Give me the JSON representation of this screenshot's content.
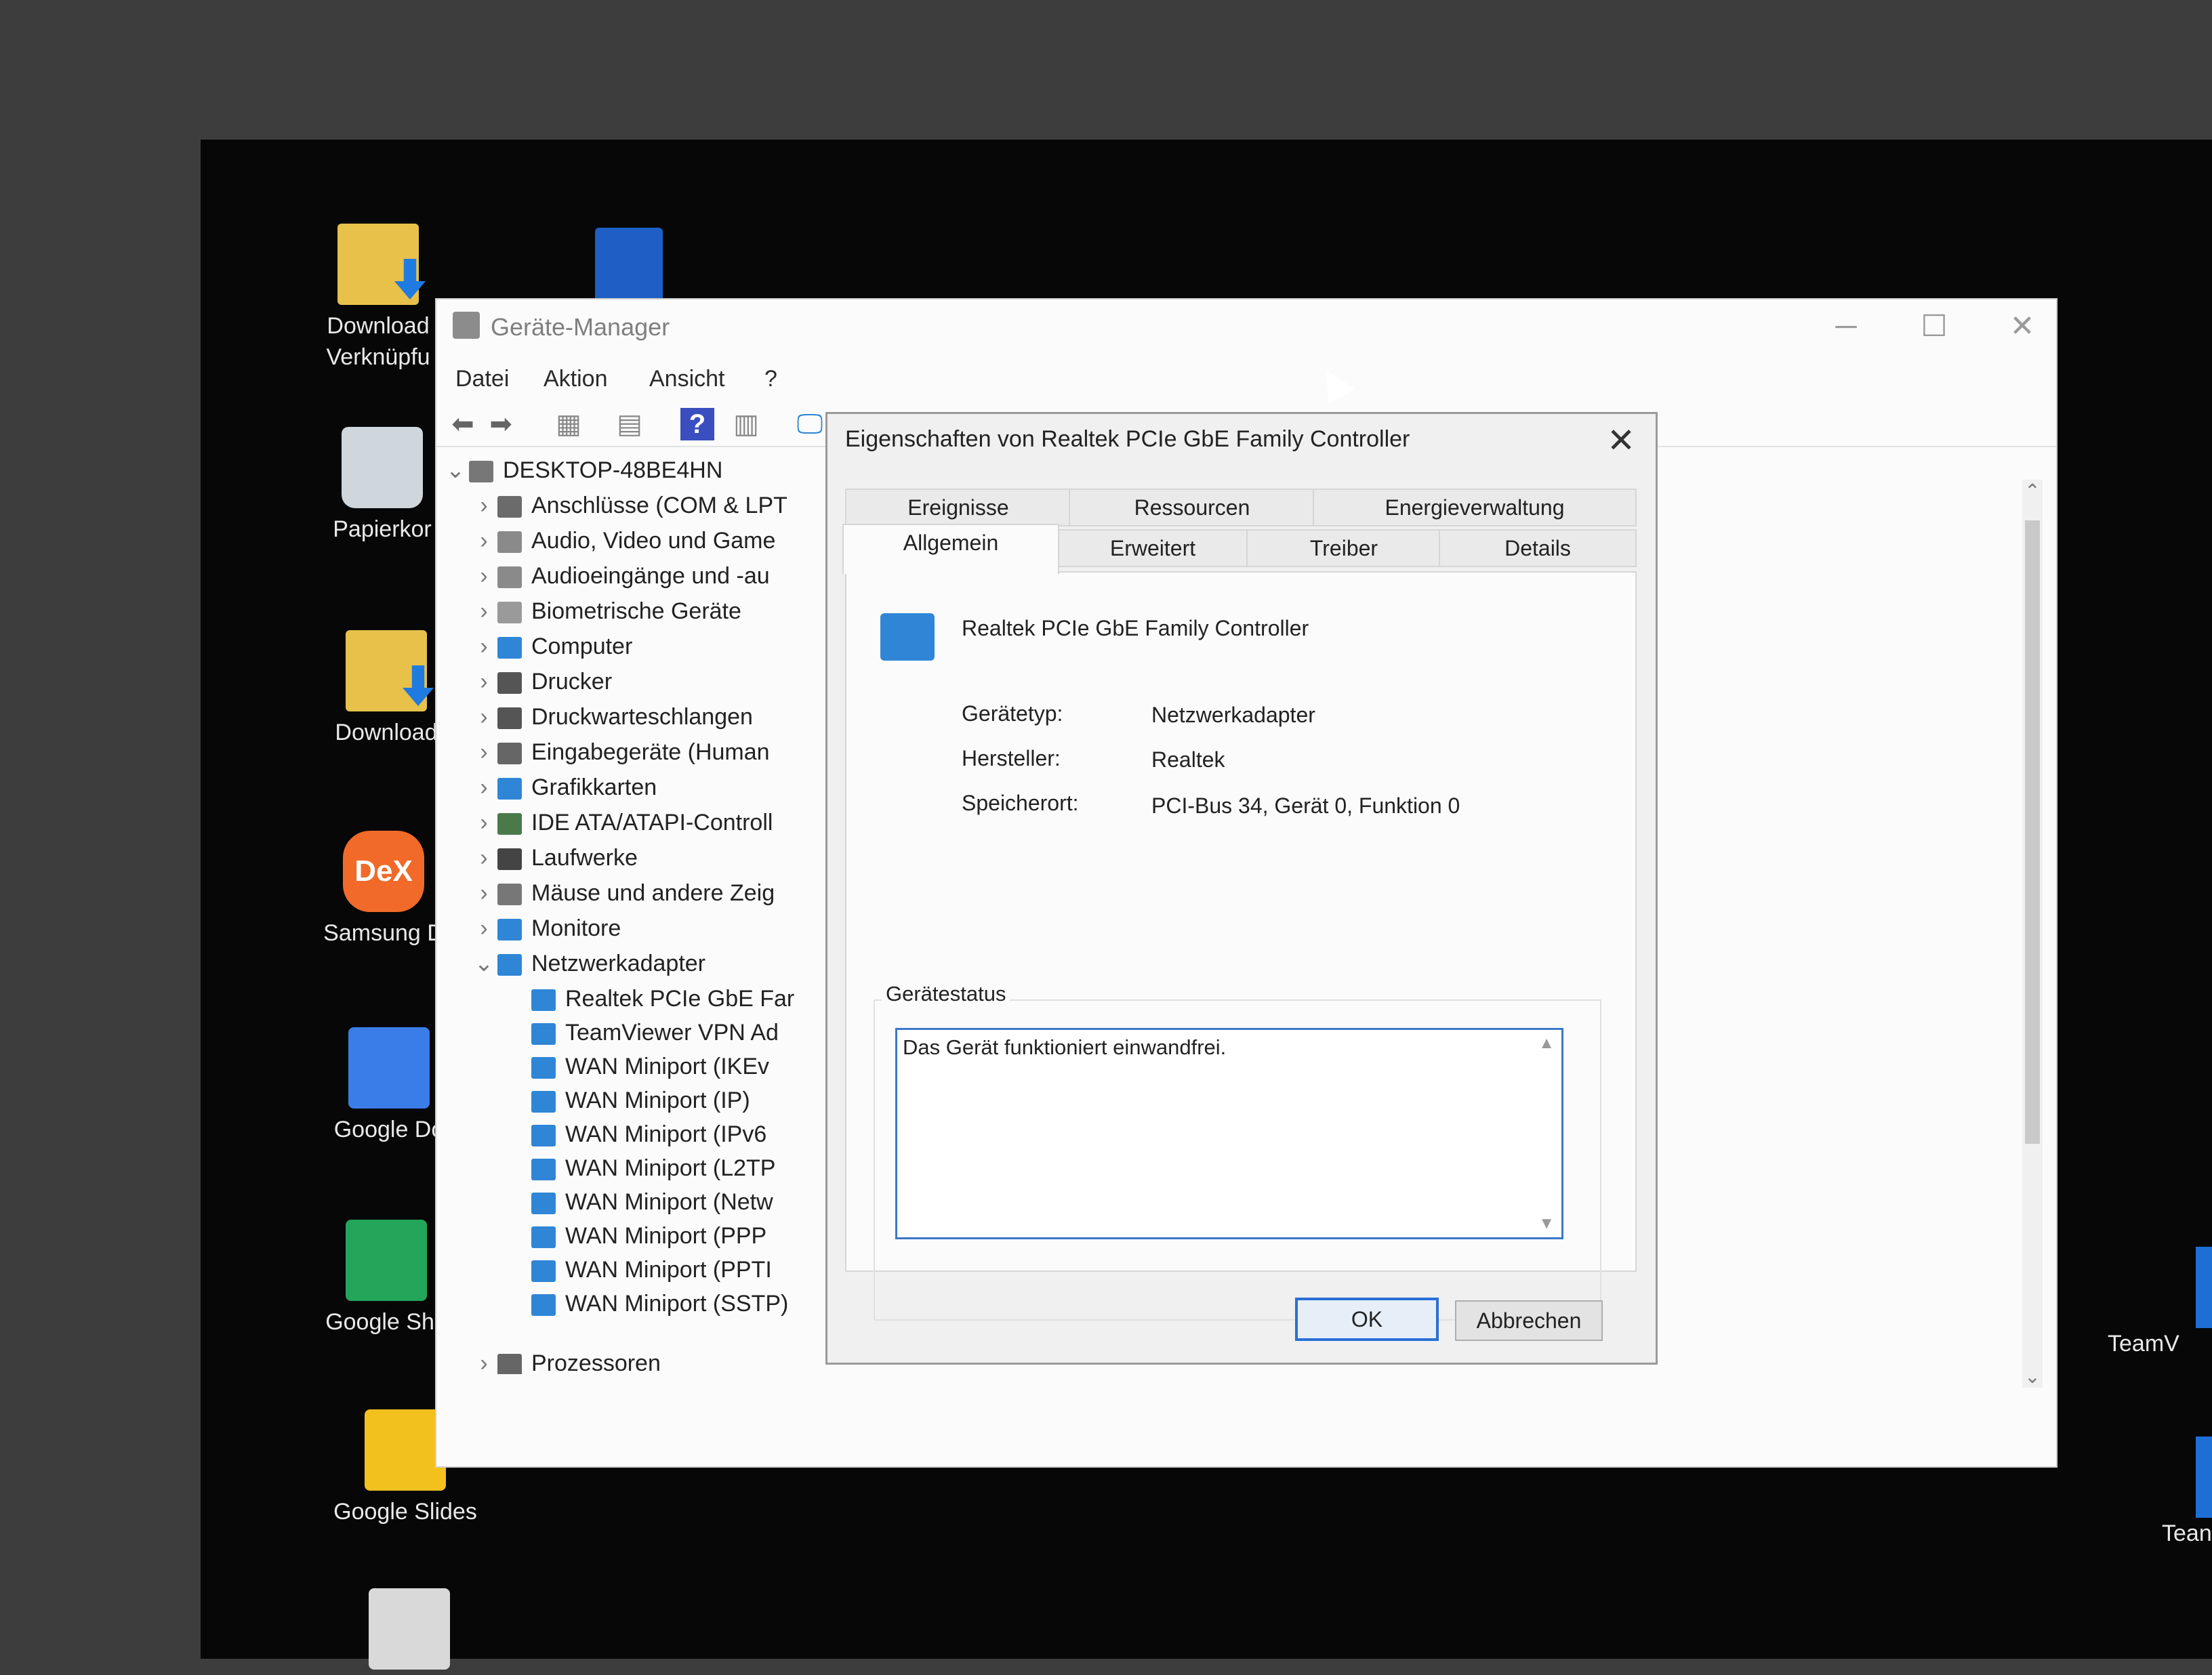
{
  "desktop": {
    "icons": [
      {
        "label": "Download\nVerknüpfu",
        "glyph": "folder-download-icon"
      },
      {
        "label": "Papierkor",
        "glyph": "recycle-bin-icon"
      },
      {
        "label": "Download",
        "glyph": "folder-download-icon"
      },
      {
        "label": "DeX",
        "glyph": "samsung-dex-icon"
      },
      {
        "label": "Samsung D",
        "glyph": "samsung-dex-icon"
      },
      {
        "label": "Google Do",
        "glyph": "google-docs-icon"
      },
      {
        "label": "Google She",
        "glyph": "google-sheets-icon"
      },
      {
        "label": "Google Slides",
        "glyph": "google-slides-icon"
      },
      {
        "label": "TeamV",
        "glyph": "teamviewer-icon"
      },
      {
        "label": "Tean",
        "glyph": "teamviewer-icon"
      }
    ]
  },
  "window": {
    "title": "Geräte-Manager",
    "controls": {
      "minimize": "─",
      "maximize": "☐",
      "close": "✕"
    },
    "menu": [
      "Datei",
      "Aktion",
      "Ansicht",
      "?"
    ],
    "tree": {
      "root": "DESKTOP-48BE4HN",
      "categories": [
        "Anschlüsse (COM & LPT",
        "Audio, Video und Game",
        "Audioeingänge und -au",
        "Biometrische Geräte",
        "Computer",
        "Drucker",
        "Druckwarteschlangen",
        "Eingabegeräte (Human",
        "Grafikkarten",
        "IDE ATA/ATAPI-Controll",
        "Laufwerke",
        "Mäuse und andere Zeig",
        "Monitore",
        "Netzwerkadapter"
      ],
      "network_children": [
        "Realtek PCIe GbE Far",
        "TeamViewer VPN Ad",
        "WAN Miniport (IKEv",
        "WAN Miniport (IP)",
        "WAN Miniport (IPv6",
        "WAN Miniport (L2TP",
        "WAN Miniport (Netw",
        "WAN Miniport (PPP",
        "WAN Miniport (PPTI",
        "WAN Miniport (SSTP)"
      ],
      "after": "Prozessoren"
    }
  },
  "dialog": {
    "title": "Eigenschaften von Realtek PCIe GbE Family Controller",
    "tabs_row1": [
      "Ereignisse",
      "Ressourcen",
      "Energieverwaltung"
    ],
    "tabs_row2": [
      "Allgemein",
      "Erweitert",
      "Treiber",
      "Details"
    ],
    "active_tab": "Allgemein",
    "device_name": "Realtek PCIe GbE Family Controller",
    "props": [
      {
        "label": "Gerätetyp:",
        "value": "Netzwerkadapter"
      },
      {
        "label": "Hersteller:",
        "value": "Realtek"
      },
      {
        "label": "Speicherort:",
        "value": "PCI-Bus 34, Gerät 0, Funktion 0"
      }
    ],
    "status_group": "Gerätestatus",
    "status_text": "Das Gerät funktioniert einwandfrei.",
    "ok": "OK",
    "cancel": "Abbrechen"
  }
}
